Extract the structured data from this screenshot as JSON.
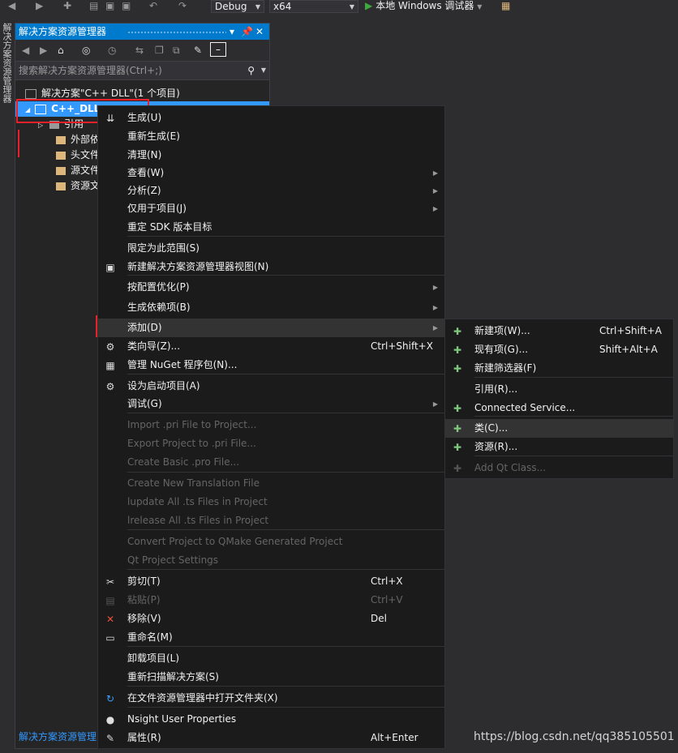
{
  "toolbar": {
    "config": "Debug",
    "platform": "x64",
    "run_label": "本地 Windows 调试器"
  },
  "side_tab": "解决方案资源管理器",
  "explorer": {
    "title": "解决方案资源管理器",
    "search_placeholder": "搜索解决方案资源管理器(Ctrl+;)",
    "solution": "解决方案\"C++ DLL\"(1 个项目)",
    "project": "C++_DLL",
    "items": [
      "引用",
      "外部依",
      "头文件",
      "源文件",
      "资源文"
    ],
    "footer": "解决方案资源管理"
  },
  "context_menu": {
    "items": [
      {
        "label": "生成(U)",
        "shortcut": "",
        "icon": "build-icon"
      },
      {
        "label": "重新生成(E)",
        "shortcut": ""
      },
      {
        "label": "清理(N)",
        "shortcut": ""
      },
      {
        "label": "查看(W)",
        "shortcut": "",
        "sub": true
      },
      {
        "label": "分析(Z)",
        "shortcut": "",
        "sub": true
      },
      {
        "label": "仅用于项目(J)",
        "shortcut": "",
        "sub": true
      },
      {
        "label": "重定 SDK 版本目标",
        "shortcut": ""
      },
      {
        "label": "限定为此范围(S)",
        "shortcut": ""
      },
      {
        "label": "新建解决方案资源管理器视图(N)",
        "shortcut": "",
        "icon": "new-view-icon"
      },
      {
        "label": "按配置优化(P)",
        "shortcut": "",
        "sub": true
      },
      {
        "label": "生成依赖项(B)",
        "shortcut": "",
        "sub": true
      },
      {
        "label": "添加(D)",
        "shortcut": "",
        "sub": true
      },
      {
        "label": "类向导(Z)...",
        "shortcut": "Ctrl+Shift+X",
        "icon": "class-wizard-icon"
      },
      {
        "label": "管理 NuGet 程序包(N)...",
        "shortcut": "",
        "icon": "nuget-icon"
      },
      {
        "label": "设为启动项目(A)",
        "shortcut": "",
        "icon": "gear-icon"
      },
      {
        "label": "调试(G)",
        "shortcut": "",
        "sub": true
      },
      {
        "label": "Import .pri File to Project...",
        "shortcut": "",
        "disabled": true
      },
      {
        "label": "Export Project to .pri File...",
        "shortcut": "",
        "disabled": true
      },
      {
        "label": "Create Basic .pro File...",
        "shortcut": "",
        "disabled": true
      },
      {
        "label": "Create New Translation File",
        "shortcut": "",
        "disabled": true
      },
      {
        "label": "lupdate All .ts Files in Project",
        "shortcut": "",
        "disabled": true
      },
      {
        "label": "lrelease All .ts Files in Project",
        "shortcut": "",
        "disabled": true
      },
      {
        "label": "Convert Project to QMake Generated Project",
        "shortcut": "",
        "disabled": true
      },
      {
        "label": "Qt Project Settings",
        "shortcut": "",
        "disabled": true
      },
      {
        "label": "剪切(T)",
        "shortcut": "Ctrl+X",
        "icon": "scissors-icon"
      },
      {
        "label": "粘贴(P)",
        "shortcut": "Ctrl+V",
        "disabled": true,
        "icon": "paste-icon"
      },
      {
        "label": "移除(V)",
        "shortcut": "Del",
        "icon": "remove-icon"
      },
      {
        "label": "重命名(M)",
        "shortcut": "",
        "icon": "rename-icon"
      },
      {
        "label": "卸载项目(L)",
        "shortcut": ""
      },
      {
        "label": "重新扫描解决方案(S)",
        "shortcut": ""
      },
      {
        "label": "在文件资源管理器中打开文件夹(X)",
        "shortcut": "",
        "icon": "refresh-icon"
      },
      {
        "label": "Nsight User Properties",
        "shortcut": "",
        "icon": "nsight-icon"
      },
      {
        "label": "属性(R)",
        "shortcut": "Alt+Enter",
        "icon": "wrench-icon"
      }
    ]
  },
  "submenu": {
    "items": [
      {
        "label": "新建项(W)...",
        "shortcut": "Ctrl+Shift+A"
      },
      {
        "label": "现有项(G)...",
        "shortcut": "Shift+Alt+A"
      },
      {
        "label": "新建筛选器(F)",
        "shortcut": ""
      },
      {
        "label": "引用(R)...",
        "shortcut": ""
      },
      {
        "label": "Connected Service...",
        "shortcut": ""
      },
      {
        "label": "类(C)...",
        "shortcut": ""
      },
      {
        "label": "资源(R)...",
        "shortcut": ""
      },
      {
        "label": "Add Qt Class...",
        "shortcut": "",
        "disabled": true
      }
    ]
  },
  "watermark": "https://blog.csdn.net/qq385105501"
}
